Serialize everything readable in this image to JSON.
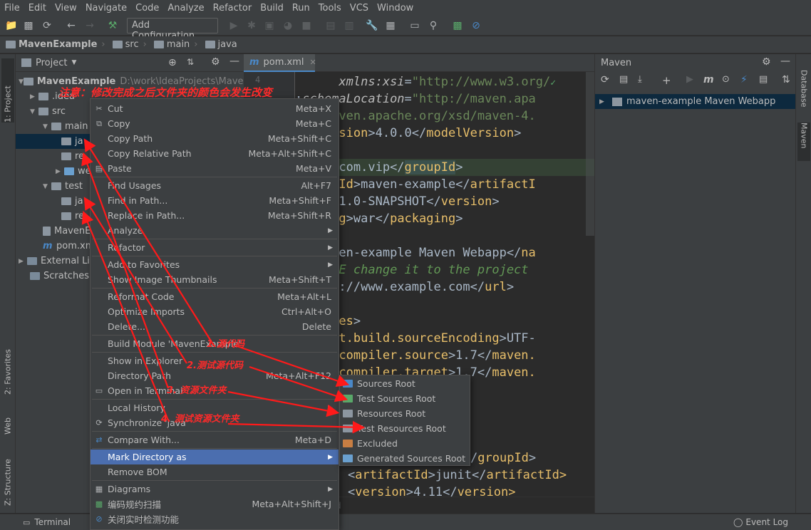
{
  "menubar": [
    "File",
    "Edit",
    "View",
    "Navigate",
    "Code",
    "Analyze",
    "Refactor",
    "Build",
    "Run",
    "Tools",
    "VCS",
    "Window"
  ],
  "toolbar": {
    "config_label": "Add Configuration..."
  },
  "navbar": {
    "crumbs": [
      "MavenExample",
      "src",
      "main",
      "java"
    ]
  },
  "left_stripe": {
    "project_tab": "1: Project",
    "favorites_tab": "2: Favorites",
    "web_tab": "Web",
    "structure_tab": "Z: Structure"
  },
  "project": {
    "title": "Project",
    "root_name": "MavenExample",
    "root_path": "D:\\work\\IdeaProjects\\MavenEx",
    "tree": [
      {
        "label": ".idea"
      },
      {
        "label": "src"
      },
      {
        "label": "main"
      },
      {
        "label": "ja"
      },
      {
        "label": "re"
      },
      {
        "label": "we"
      },
      {
        "label": "test"
      },
      {
        "label": "ja"
      },
      {
        "label": "re"
      },
      {
        "label": "MavenE"
      },
      {
        "label": "pom.xm"
      },
      {
        "label": "External Lib"
      },
      {
        "label": "Scratches a"
      }
    ]
  },
  "editor": {
    "tab_label": "pom.xml",
    "line_number": "4",
    "lines": [
      {
        "a": "      ",
        "b": "xmlns:xsi",
        "c": "=",
        "d": "\"http://www.w3.org/"
      },
      {
        "a": ":",
        "b": "schemaLocation",
        "c": "=",
        "d": "\"http://maven.apa"
      },
      {
        "a": "p://maven.apache.org/xsd/maven-4.",
        "b": "",
        "c": "",
        "d": ""
      },
      {
        "a": "delVersion",
        "b": ">4.0.0</",
        "c": "modelVersion",
        "d": ">"
      },
      {
        "a": "",
        "b": "",
        "c": "",
        "d": ""
      },
      {
        "a": "oupId",
        "b": ">com.vip</",
        "c": "groupId",
        "d": ">"
      },
      {
        "a": "tifactId",
        "b": ">maven-example</",
        "c": "artifactI",
        "d": ""
      },
      {
        "a": "rsion",
        "b": ">1.0-SNAPSHOT</",
        "c": "version",
        "d": ">"
      },
      {
        "a": "ckaging",
        "b": ">war</",
        "c": "packaging",
        "d": ">"
      },
      {
        "a": "",
        "b": "",
        "c": "",
        "d": ""
      },
      {
        "a": "me",
        "b": ">maven-example Maven Webapp</",
        "c": "na",
        "d": ""
      },
      {
        "a": "- ",
        "b": "FIXME change it to the project",
        "c": "",
        "d": ""
      },
      {
        "a": "l",
        "b": ">http://www.example.com</",
        "c": "url",
        "d": ">"
      },
      {
        "a": "",
        "b": "",
        "c": "",
        "d": ""
      },
      {
        "a": "operties",
        "b": ">",
        "c": "",
        "d": ""
      },
      {
        "a": "project.build.sourceEncoding",
        "b": ">UTF-",
        "c": "",
        "d": ""
      },
      {
        "a": "maven.compiler.source",
        "b": ">1.7</",
        "c": "maven.",
        "d": ""
      },
      {
        "a": "maven.compiler.target",
        "b": ">1.7</",
        "c": "maven.",
        "d": ""
      },
      {
        "a": "",
        "b": "",
        "c": "",
        "d": ""
      },
      {
        "a": "",
        "b": "",
        "c": "",
        "d": ""
      },
      {
        "a": "",
        "b": "",
        "c": "",
        "d": ""
      },
      {
        "a": "",
        "b": "",
        "c": "",
        "d": ""
      },
      {
        "a": "/",
        "b": "groupId",
        "c": ">",
        "d": ""
      },
      {
        "a": "<",
        "b": "artifactId",
        "c": ">junit</",
        "d": "artifactId>"
      },
      {
        "a": "<",
        "b": "version",
        "c": ">4.11</",
        "d": "version>"
      }
    ],
    "bottom_breadcrumb": "groupId"
  },
  "context_menu": {
    "items": [
      {
        "label": "Cut",
        "shortcut": "Meta+X"
      },
      {
        "label": "Copy",
        "shortcut": "Meta+C"
      },
      {
        "label": "Copy Path",
        "shortcut": "Meta+Shift+C"
      },
      {
        "label": "Copy Relative Path",
        "shortcut": "Meta+Alt+Shift+C"
      },
      {
        "label": "Paste",
        "shortcut": "Meta+V"
      },
      {
        "label": "Find Usages",
        "shortcut": "Alt+F7"
      },
      {
        "label": "Find in Path...",
        "shortcut": "Meta+Shift+F"
      },
      {
        "label": "Replace in Path...",
        "shortcut": "Meta+Shift+R"
      },
      {
        "label": "Analyze",
        "shortcut": ""
      },
      {
        "label": "Refactor",
        "shortcut": ""
      },
      {
        "label": "Add to Favorites",
        "shortcut": ""
      },
      {
        "label": "Show Image Thumbnails",
        "shortcut": "Meta+Shift+T"
      },
      {
        "label": "Reformat Code",
        "shortcut": "Meta+Alt+L"
      },
      {
        "label": "Optimize Imports",
        "shortcut": "Ctrl+Alt+O"
      },
      {
        "label": "Delete...",
        "shortcut": "Delete"
      },
      {
        "label": "Build Module 'MavenExample'",
        "shortcut": ""
      },
      {
        "label": "Show in Explorer",
        "shortcut": ""
      },
      {
        "label": "Directory Path",
        "shortcut": "Meta+Alt+F12"
      },
      {
        "label": "Open in Terminal",
        "shortcut": ""
      },
      {
        "label": "Local History",
        "shortcut": ""
      },
      {
        "label": "Synchronize 'java'",
        "shortcut": ""
      },
      {
        "label": "Compare With...",
        "shortcut": "Meta+D"
      },
      {
        "label": "Mark Directory as",
        "shortcut": ""
      },
      {
        "label": "Remove BOM",
        "shortcut": ""
      },
      {
        "label": "Diagrams",
        "shortcut": ""
      },
      {
        "label": "编码规约扫描",
        "shortcut": "Meta+Alt+Shift+J"
      },
      {
        "label": "关闭实时检测功能",
        "shortcut": ""
      }
    ]
  },
  "sub_menu": {
    "items": [
      {
        "label": "Sources Root",
        "color": "#4a88c7"
      },
      {
        "label": "Test Sources Root",
        "color": "#59a869"
      },
      {
        "label": "Resources Root",
        "color": "#8c96a0"
      },
      {
        "label": "Test Resources Root",
        "color": "#8c96a0"
      },
      {
        "label": "Excluded",
        "color": "#c87e43"
      },
      {
        "label": "Generated Sources Root",
        "color": "#6aa0cf"
      }
    ]
  },
  "maven": {
    "title": "Maven",
    "project_label": "maven-example Maven Webapp"
  },
  "right_stripe": {
    "database_tab": "Database",
    "maven_tab": "Maven"
  },
  "statusbar": {
    "terminal": "Terminal",
    "event_log": "Event Log"
  },
  "annotations": {
    "title": "注意：修改完成之后文件夹的颜色会发生改变",
    "a1": "1.源代码",
    "a2": "2.测试源代码",
    "a3": "3. 资源文件夹",
    "a4": "4. 测试资源文件夹"
  }
}
